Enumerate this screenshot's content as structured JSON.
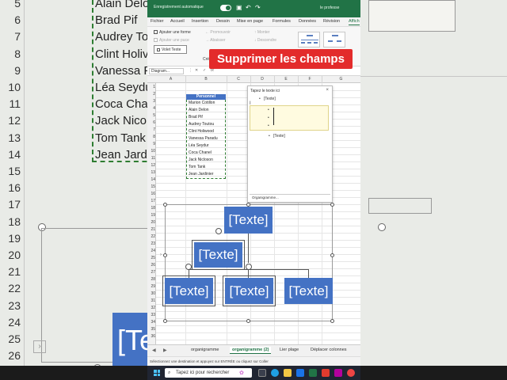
{
  "background": {
    "row_numbers": [
      "5",
      "6",
      "7",
      "8",
      "9",
      "10",
      "11",
      "12",
      "13",
      "14",
      "15",
      "16",
      "17",
      "18",
      "19",
      "20",
      "21",
      "22",
      "23",
      "24",
      "25",
      "26"
    ],
    "names": [
      "Alain Deloi",
      "Brad Pif",
      "Audrey To",
      "Clint Holiv",
      "Vanessa Pa",
      "Léa Seydu",
      "Coca Chan",
      "Jack Nicol",
      "Tom Tank",
      "Jean Jardi"
    ],
    "partial_node": "[Te"
  },
  "titlebar": {
    "autosave_label": "Enregistrement automatique",
    "doc_name": "le professe"
  },
  "menu": {
    "items": [
      "Fichier",
      "Accueil",
      "Insertion",
      "Dessin",
      "Mise en page",
      "Formules",
      "Données",
      "Révision",
      "Affich"
    ],
    "active_index": 8
  },
  "ribbon": {
    "add_shape": "Ajouter une forme",
    "add_bullet": "Ajouter une puce",
    "text_pane": "Volet Texte",
    "promote": "← Promouvoir",
    "demote": "→ Abaisser",
    "move_up": "↑ Monter",
    "move_down": "↓ Descendre",
    "cre": "Cré"
  },
  "formula_bar": {
    "name_box": "Diagram...",
    "fx": "fx"
  },
  "columns": [
    "A",
    "B",
    "C",
    "D",
    "E",
    "F",
    "G"
  ],
  "rows": [
    "1",
    "2",
    "3",
    "4",
    "5",
    "6",
    "7",
    "8",
    "9",
    "10",
    "11",
    "12",
    "13",
    "14",
    "15",
    "16",
    "17",
    "18",
    "19",
    "20",
    "21",
    "22",
    "23",
    "24",
    "25",
    "26",
    "27",
    "28",
    "29",
    "30",
    "31",
    "32",
    "33",
    "34",
    "35",
    "36"
  ],
  "table": {
    "header": "Personnel",
    "names": [
      "Marion Cotillon",
      "Alain Delon",
      "Brad Pif",
      "Audrey Toutou",
      "Clint Holiwood",
      "Vanessa Paradu",
      "Léa Seydur",
      "Coca Chanel",
      "Jack Nicloson",
      "Tom Tank",
      "Jean Jardinier"
    ]
  },
  "text_pane": {
    "title": "Tapez le texte ici",
    "close": "×",
    "first_line": "[Texte]",
    "last_line": "[Texte]",
    "bullet": "•",
    "footer_link": "Organigramme..."
  },
  "smartart": {
    "nodes": [
      "[Texte]",
      "[Texte]",
      "[Texte]",
      "[Texte]",
      "[Texte]"
    ]
  },
  "sheet_tabs": {
    "tabs": [
      "organigramme",
      "organigramme (2)",
      "Lier plage",
      "Déplacer colonnes"
    ],
    "active_index": 1,
    "nav_prev": "◀",
    "nav_next": "▶"
  },
  "status": {
    "text": "Sélectionnez une destination et appuyez sur ENTRÉE ou cliquez sur Coller"
  },
  "taskbar": {
    "search_placeholder": "Tapez ici pour rechercher"
  },
  "caption": {
    "text": "Supprimer les champs"
  },
  "colors": {
    "excel_green": "#217346",
    "node_blue": "#4472c4",
    "caption_red": "#e32b2b"
  }
}
